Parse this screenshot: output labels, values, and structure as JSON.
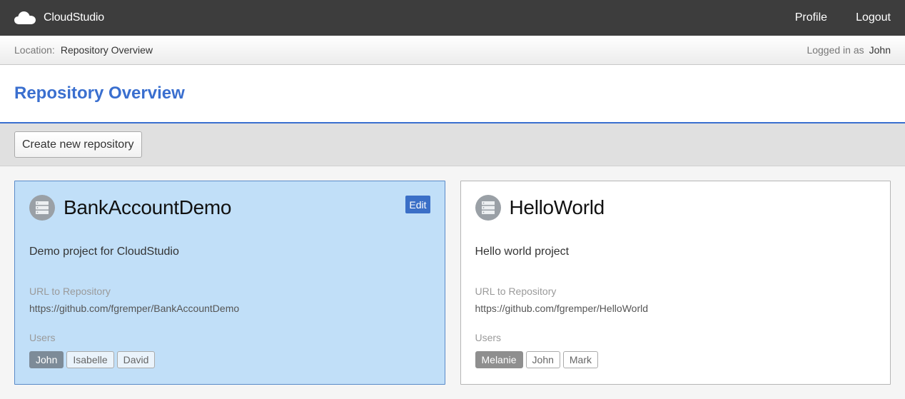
{
  "app": {
    "brand": "CloudStudio",
    "brand_icon": "cloud-icon"
  },
  "nav": {
    "profile": "Profile",
    "logout": "Logout"
  },
  "location": {
    "label": "Location:",
    "value": "Repository Overview",
    "logged_label": "Logged in as",
    "user": "John"
  },
  "page": {
    "title": "Repository Overview"
  },
  "toolbar": {
    "create_label": "Create new repository"
  },
  "colors": {
    "accent": "#3a6fcf",
    "selected_card": "#c1dff8",
    "topbar": "#3d3d3d"
  },
  "repos": [
    {
      "name": "BankAccountDemo",
      "edit_label": "Edit",
      "description": "Demo project for CloudStudio",
      "url_label": "URL to Repository",
      "url": "https://github.com/fgremper/BankAccountDemo",
      "users_label": "Users",
      "users": [
        "John",
        "Isabelle",
        "David"
      ]
    },
    {
      "name": "HelloWorld",
      "description": "Hello world project",
      "url_label": "URL to Repository",
      "url": "https://github.com/fgremper/HelloWorld",
      "users_label": "Users",
      "users": [
        "Melanie",
        "John",
        "Mark"
      ]
    }
  ]
}
